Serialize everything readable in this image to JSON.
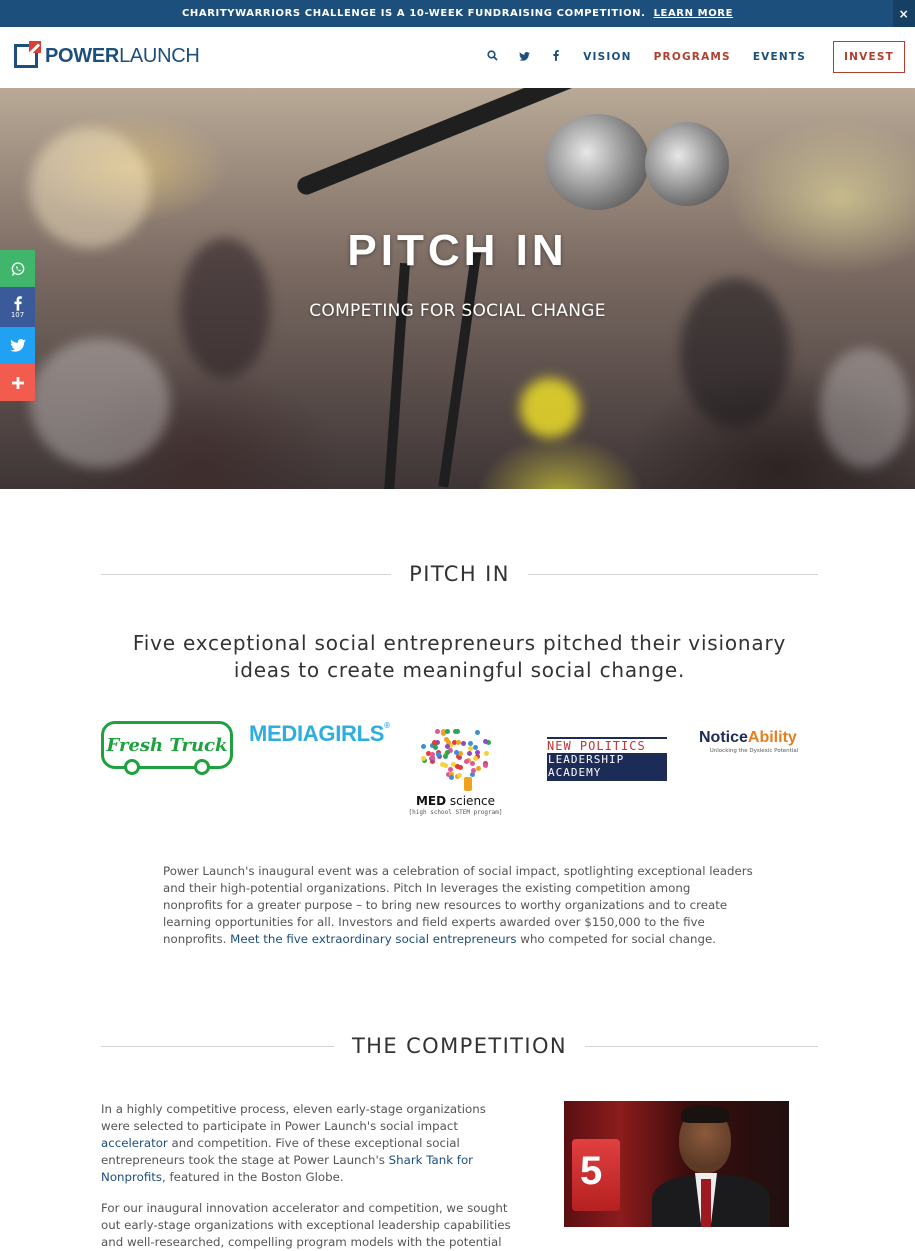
{
  "announcement": {
    "text": "CHARITYWARRIORS CHALLENGE IS A 10-WEEK FUNDRAISING COMPETITION.",
    "link": "LEARN MORE",
    "close": "×"
  },
  "header": {
    "logo_bold": "POWER",
    "logo_light": "LAUNCH",
    "nav": [
      "VISION",
      "PROGRAMS",
      "EVENTS"
    ],
    "active_nav": "PROGRAMS",
    "invest": "INVEST",
    "icons": [
      "search-icon",
      "twitter-icon",
      "facebook-icon"
    ]
  },
  "hero": {
    "title": "PITCH IN",
    "subtitle": "COMPETING FOR SOCIAL CHANGE"
  },
  "share": {
    "facebook_count": "107",
    "icons": [
      "whatsapp-icon",
      "facebook-icon",
      "twitter-icon",
      "plus-icon"
    ]
  },
  "section1": {
    "heading": "PITCH IN",
    "lead": "Five exceptional social entrepreneurs pitched their visionary ideas to create meaningful social change.",
    "body_before_link": "Power Launch's inaugural event was a celebration of social impact, spotlighting exceptional leaders and their high-potential organizations. Pitch In leverages the existing competition among nonprofits for a greater purpose – to bring new resources to worthy organizations and to create learning opportunities for all. Investors and field experts awarded over $150,000 to the five nonprofits. ",
    "body_link": "Meet the five extraordinary social entrepreneurs",
    "body_after_link": " who competed for social change."
  },
  "logos": {
    "fresh_truck": "Fresh Truck",
    "media_girls": "MEDIAGIRLS",
    "media_girls_mark": "®",
    "med_science_bold": "MED",
    "med_science_light": " science",
    "med_science_sub": "[high school STEM program]",
    "npla_lines": [
      "NEW POLITICS",
      "LEADERSHIP",
      "ACADEMY"
    ],
    "noticeability_a": "Notice",
    "noticeability_b": "Ability",
    "noticeability_sub": "Unlocking the Dyslexic Potential"
  },
  "section2": {
    "heading": "THE COMPETITION",
    "p1_a": "In a highly competitive process, eleven early-stage organizations were selected to participate in Power Launch's social impact ",
    "p1_link1": "accelerator",
    "p1_b": " and competition. Five of these exceptional social entrepreneurs took the stage at Power Launch's ",
    "p1_link2": "Shark Tank for Nonprofits",
    "p1_c": ", featured in the Boston Globe.",
    "p2": "For our inaugural innovation accelerator and competition, we sought out early-stage organizations with exceptional leadership capabilities and well-researched, compelling program models with the potential for",
    "photo_channel": "5"
  },
  "colors": {
    "brand_blue": "#1d4f7c",
    "accent_red": "#b0402d",
    "fresh_truck_green": "#1fa23e"
  }
}
